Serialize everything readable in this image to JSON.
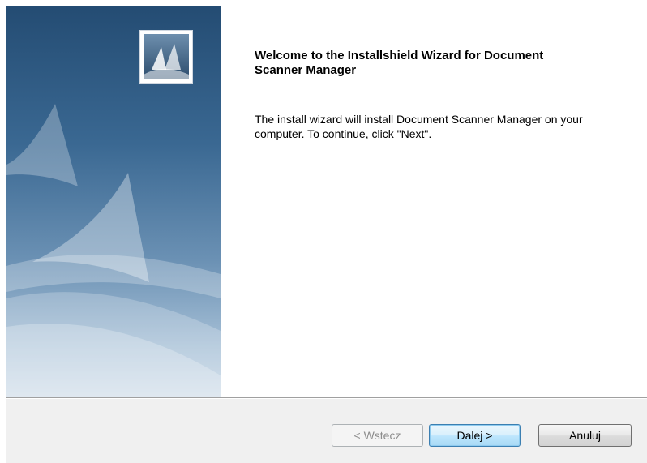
{
  "wizard": {
    "title": "Welcome to the Installshield Wizard for Document Scanner Manager",
    "description": "The install wizard will install Document Scanner Manager on your computer. To continue, click \"Next\"."
  },
  "buttons": {
    "back_label": "< Wstecz",
    "next_label": "Dalej >",
    "cancel_label": "Anuluj"
  },
  "icons": {
    "logo": "installshield-logo-icon",
    "banner": "sail-banner-graphic"
  },
  "colors": {
    "banner_top": "#244c73",
    "banner_bottom": "#c9d8e6",
    "footer_bg": "#f0f0f0",
    "next_button_accent": "#3c7fb1"
  }
}
